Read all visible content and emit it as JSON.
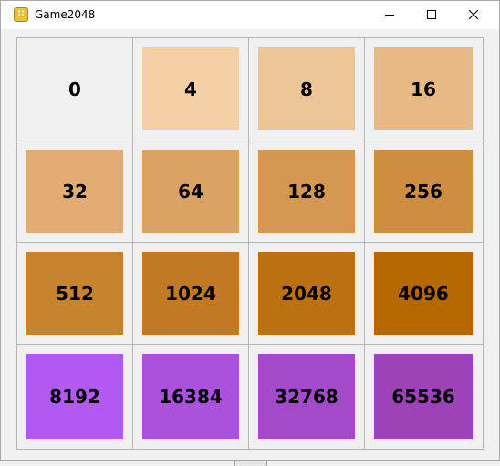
{
  "window": {
    "title": "Game2048",
    "icon": "game-app-icon",
    "icon_glyph": "∷",
    "controls": [
      "minimize-icon",
      "maximize-icon",
      "close-icon"
    ]
  },
  "board": {
    "tiles": [
      {
        "value": "0",
        "color": "#f0f0f0"
      },
      {
        "value": "4",
        "color": "#f5cfa6"
      },
      {
        "value": "8",
        "color": "#eec596"
      },
      {
        "value": "16",
        "color": "#e8b985"
      },
      {
        "value": "32",
        "color": "#e1ad74"
      },
      {
        "value": "64",
        "color": "#daa263"
      },
      {
        "value": "128",
        "color": "#d49853"
      },
      {
        "value": "256",
        "color": "#cd8e42"
      },
      {
        "value": "512",
        "color": "#c78430"
      },
      {
        "value": "1024",
        "color": "#c17a23"
      },
      {
        "value": "2048",
        "color": "#bb7112"
      },
      {
        "value": "4096",
        "color": "#b56700"
      },
      {
        "value": "8192",
        "color": "#b05af0"
      },
      {
        "value": "16384",
        "color": "#aa52dc"
      },
      {
        "value": "32768",
        "color": "#a34ac9"
      },
      {
        "value": "65536",
        "color": "#9e42b8"
      }
    ]
  }
}
